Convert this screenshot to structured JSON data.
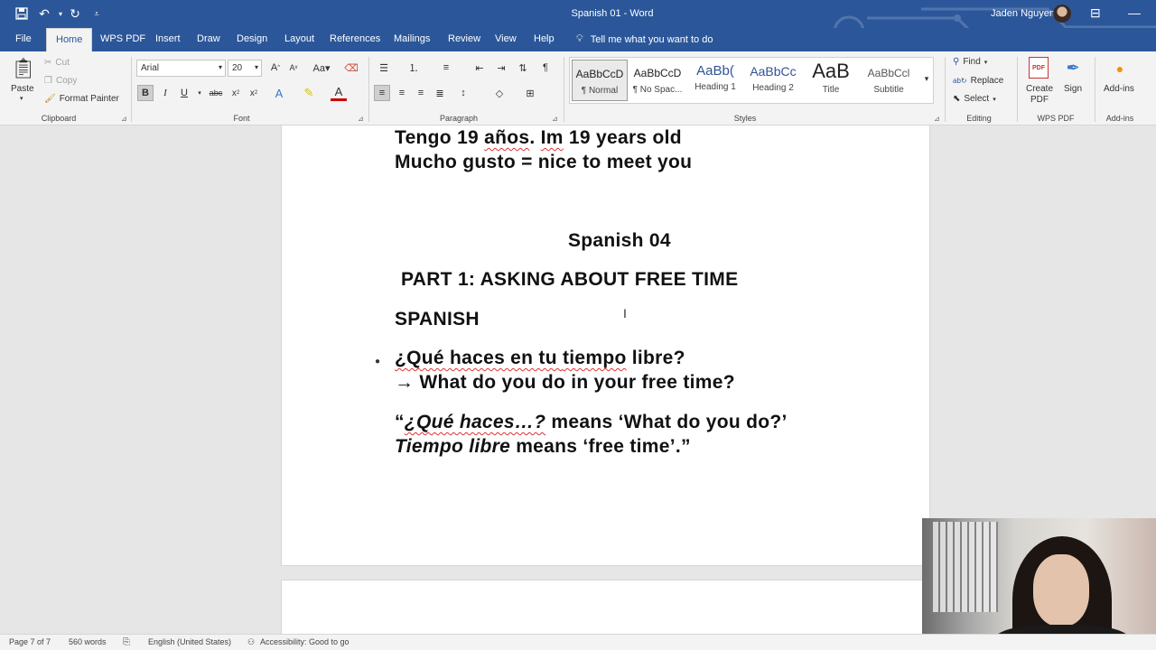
{
  "titlebar": {
    "document_title": "Spanish 01  -  Word",
    "user_name": "Jaden Nguyen",
    "quick_access": [
      {
        "name": "save-icon",
        "glyph": "🖫"
      },
      {
        "name": "undo-icon",
        "glyph": "↶"
      },
      {
        "name": "redo-icon",
        "glyph": "↻"
      }
    ]
  },
  "tabs": {
    "file": "File",
    "items": [
      "Home",
      "WPS PDF",
      "Insert",
      "Draw",
      "Design",
      "Layout",
      "References",
      "Mailings",
      "Review",
      "View",
      "Help"
    ],
    "active": "Home",
    "tell_me": "Tell me what you want to do"
  },
  "ribbon": {
    "clipboard": {
      "paste": "Paste",
      "cut": "Cut",
      "copy": "Copy",
      "format_painter": "Format Painter",
      "label": "Clipboard"
    },
    "font": {
      "name": "Arial",
      "size": "20",
      "label": "Font"
    },
    "paragraph": {
      "label": "Paragraph"
    },
    "styles": {
      "label": "Styles",
      "items": [
        {
          "sample": "AaBbCcD",
          "name": "¶ Normal"
        },
        {
          "sample": "AaBbCcD",
          "name": "¶ No Spac..."
        },
        {
          "sample": "AaBb(",
          "name": "Heading 1"
        },
        {
          "sample": "AaBbCc",
          "name": "Heading 2"
        },
        {
          "sample": "AaB",
          "name": "Title"
        },
        {
          "sample": "AaBbCcl",
          "name": "Subtitle"
        }
      ]
    },
    "editing": {
      "find": "Find",
      "replace": "Replace",
      "select": "Select",
      "label": "Editing"
    },
    "wps": {
      "create_pdf": "Create PDF",
      "sign": "Sign",
      "label": "WPS PDF"
    },
    "addins": {
      "button": "Add-ins",
      "label": "Add-ins"
    }
  },
  "document": {
    "line1": "Tengo 19 años. Im 19 years old",
    "line1_parts": [
      "Tengo 19 ",
      "años",
      ". ",
      "Im",
      " 19 years old"
    ],
    "line2": "Mucho gusto = nice to meet you",
    "heading": "Spanish 04",
    "part": "PART 1: ASKING ABOUT FREE TIME",
    "section": "SPANISH",
    "question_parts": [
      "¿Qué haces en tu ",
      "tiempo",
      " libre?"
    ],
    "answer": "→ What do you do in your free time?",
    "note_line1": {
      "open": "“",
      "italic": "¿Qué haces…?",
      "rest": " means ‘What do you do?’"
    },
    "note_line2": {
      "italic": "Tiempo libre",
      "rest": " means ‘free time’.”"
    }
  },
  "statusbar": {
    "page": "Page 7 of 7",
    "words": "560 words",
    "language": "English (United States)",
    "accessibility": "Accessibility: Good to go"
  },
  "colors": {
    "accent": "#2b579a",
    "spell_error": "#d33"
  }
}
